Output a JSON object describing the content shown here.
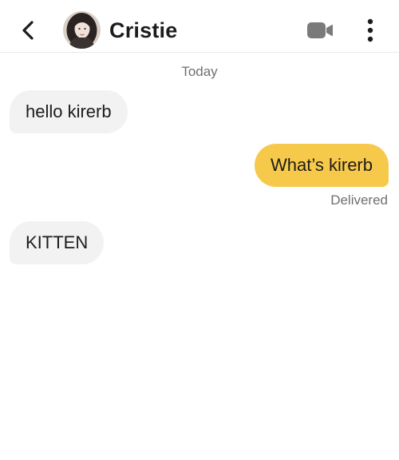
{
  "header": {
    "contact_name": "Cristie",
    "back_icon": "chevron-left-icon",
    "video_icon": "video-camera-icon",
    "more_icon": "vertical-dots-icon"
  },
  "conversation": {
    "date_separator": "Today",
    "messages": [
      {
        "direction": "incoming",
        "text": "hello kirerb"
      },
      {
        "direction": "outgoing",
        "text": "What’s kirerb",
        "status": "Delivered"
      },
      {
        "direction": "incoming",
        "text": "KITTEN"
      }
    ]
  },
  "colors": {
    "outgoing_bubble": "#f7c94a",
    "incoming_bubble": "#f2f2f2",
    "text": "#1c1c1c",
    "muted_text": "#6f6f6f"
  }
}
